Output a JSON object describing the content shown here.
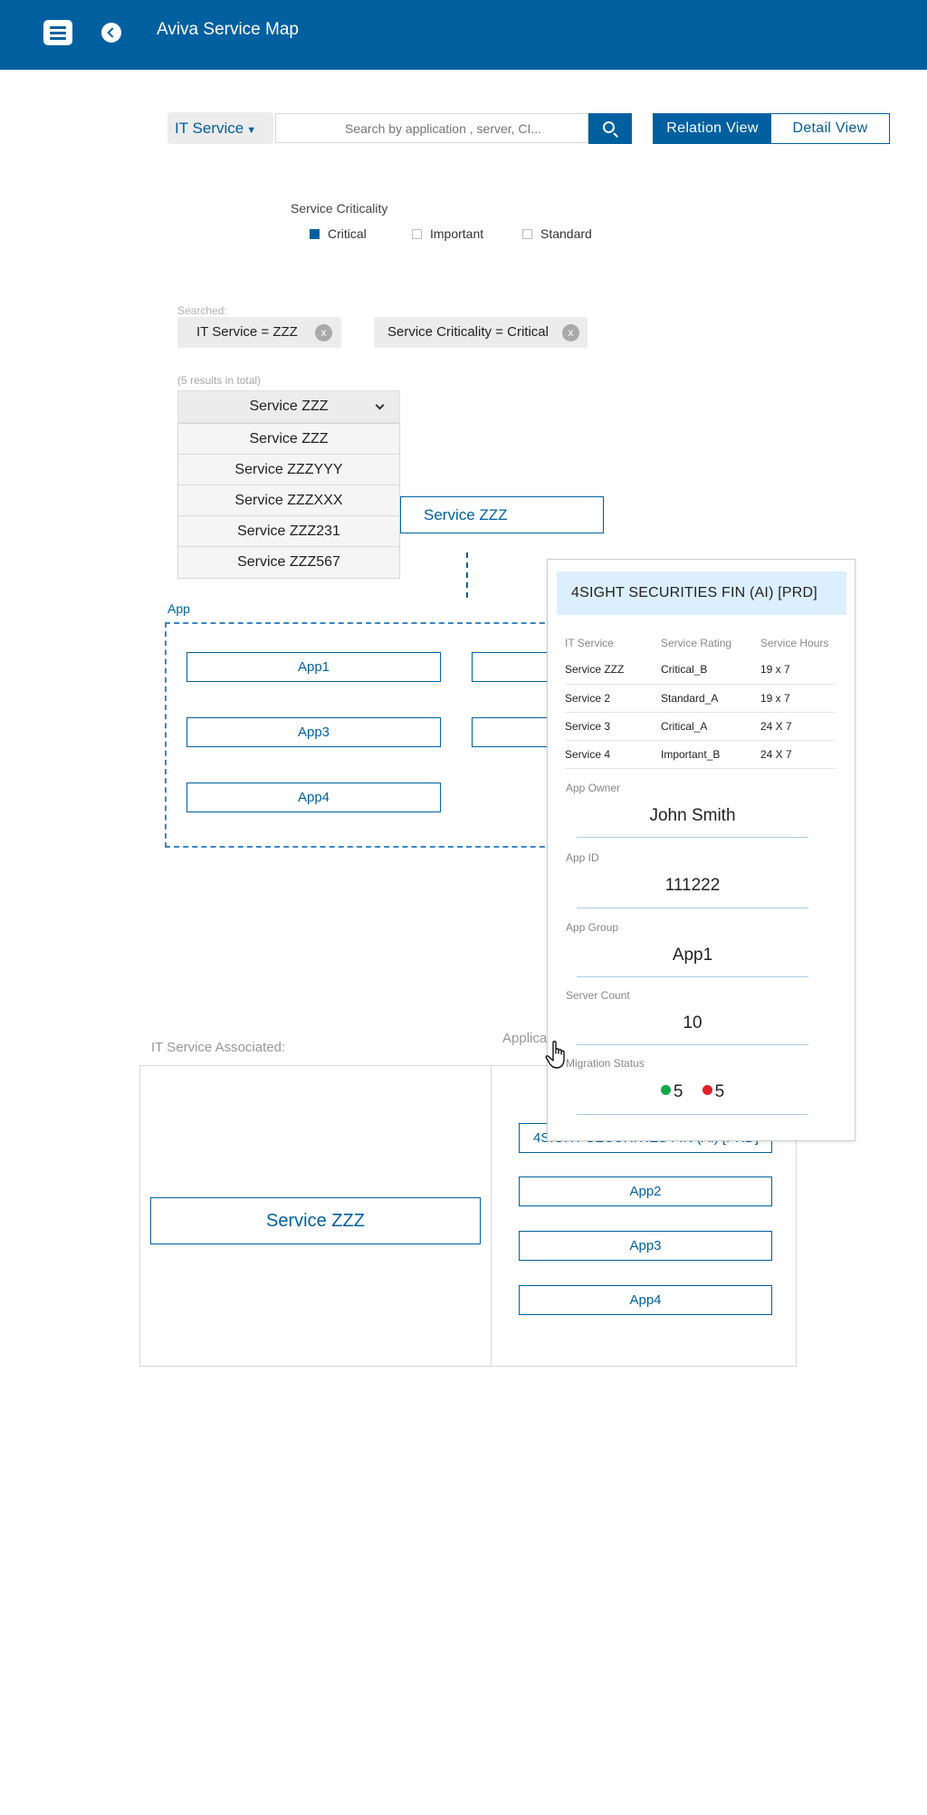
{
  "header": {
    "title": "Aviva Service Map"
  },
  "search": {
    "type_select": "IT Service",
    "placeholder": "Search by application , server, CI...",
    "views": [
      "Relation View",
      "Detail View"
    ],
    "active_view": "Relation View"
  },
  "criticality": {
    "title": "Service Criticality",
    "options": [
      {
        "label": "Critical",
        "checked": true
      },
      {
        "label": "Important",
        "checked": false
      },
      {
        "label": "Standard",
        "checked": false
      }
    ]
  },
  "searched": {
    "label": "Searched:",
    "chips": [
      {
        "text": "IT Service = ZZZ",
        "remove": "x"
      },
      {
        "text": "Service Criticality = Critical",
        "remove": "x"
      }
    ]
  },
  "results": {
    "count_text": "(5 results in total)",
    "selected": "Service ZZZ",
    "items": [
      "Service ZZZ",
      "Service ZZZYYY",
      "Service ZZZXXX",
      "Service ZZZ231",
      "Service ZZZ567"
    ]
  },
  "relation": {
    "service": "Service ZZZ",
    "group_label": "App",
    "apps": [
      "App1",
      "App3",
      "App4"
    ]
  },
  "associated": {
    "service_label": "IT Service Associated:",
    "apps_label": "Applica",
    "service": "Service ZZZ",
    "first_app": "4SIGHT SECURITIES FIN (AI)  [PRD]",
    "apps": [
      "App2",
      "App3",
      "App4"
    ]
  },
  "popup": {
    "title": "4SIGHT SECURITIES FIN (AI)  [PRD]",
    "table": {
      "headers": [
        "IT Service",
        "Service Rating",
        "Service Hours"
      ],
      "rows": [
        [
          "Service ZZZ",
          "Critical_B",
          "19 x 7"
        ],
        [
          "Service 2",
          "Standard_A",
          "19 x 7"
        ],
        [
          "Service 3",
          "Critical_A",
          "24 X 7"
        ],
        [
          "Service 4",
          "Important_B",
          "24 X 7"
        ]
      ]
    },
    "app_owner_label": "App Owner",
    "app_owner": "John Smith",
    "app_id_label": "App ID",
    "app_id": "111222",
    "app_group_label": "App Group",
    "app_group": "App1",
    "server_count_label": "Server Count",
    "server_count": "10",
    "migration_label": "Migration Status",
    "migration_green": "5",
    "migration_red": "5",
    "colors": {
      "green": "#11a84b",
      "red": "#e0202a"
    }
  },
  "colors": {
    "brand": "#00609f",
    "chip_bg": "#ececec",
    "popup_title_bg": "#dcefff"
  }
}
